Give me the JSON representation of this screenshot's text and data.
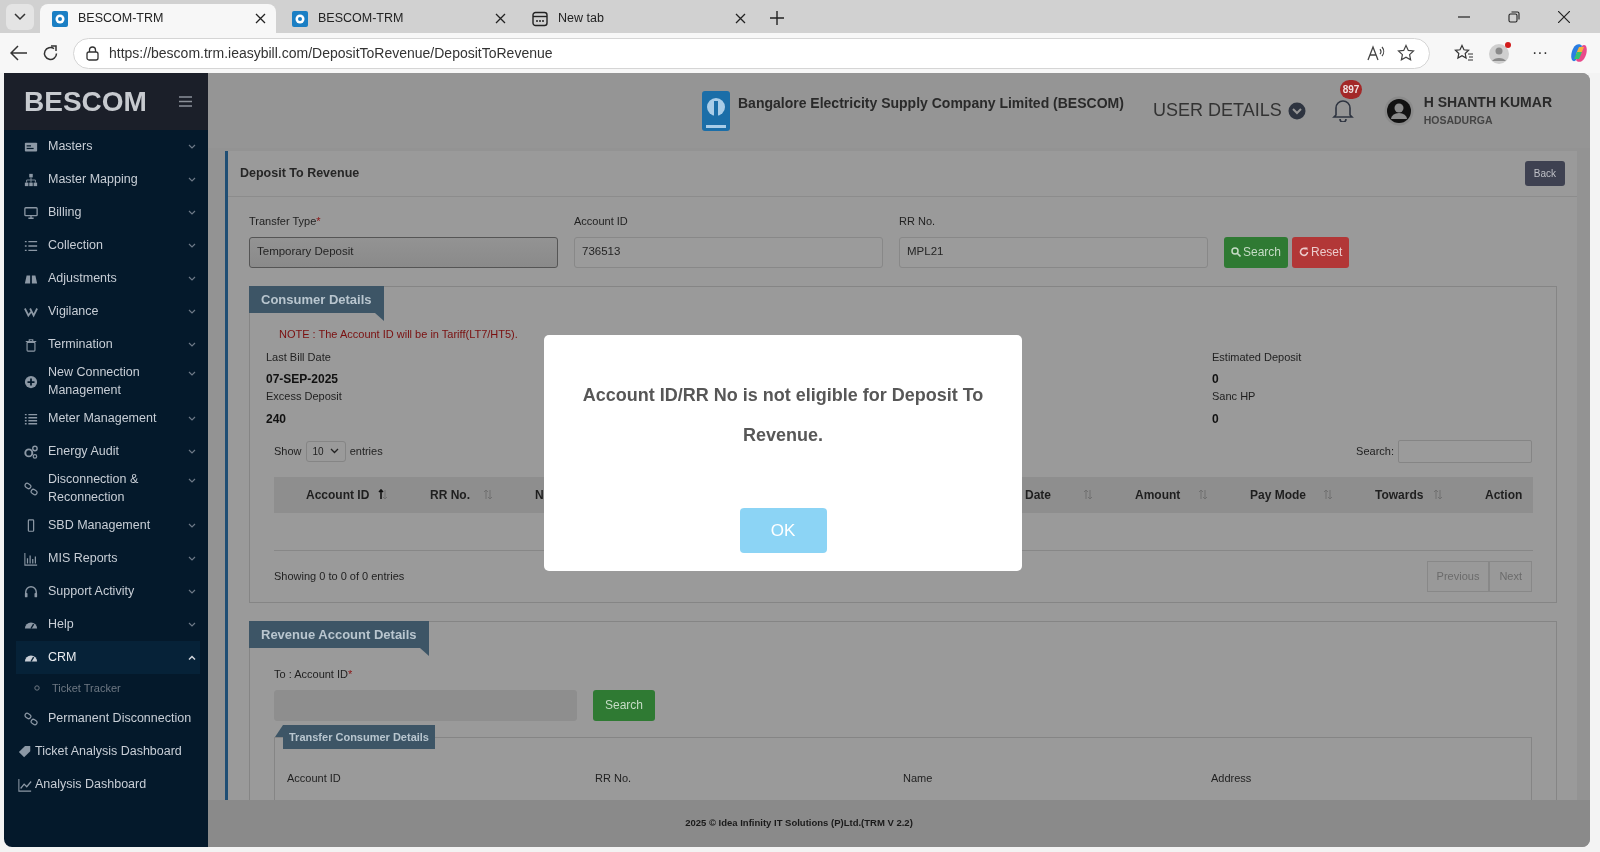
{
  "browser": {
    "tabs": [
      {
        "title": "BESCOM-TRM",
        "selected": true,
        "kind": "site"
      },
      {
        "title": "BESCOM-TRM",
        "selected": false,
        "kind": "site"
      },
      {
        "title": "New tab",
        "selected": false,
        "kind": "newtab"
      }
    ],
    "url": "https://bescom.trm.ieasybill.com/DepositToRevenue/DepositToRevenue",
    "more": "···"
  },
  "sidebar": {
    "brand": "BESCOM",
    "items": [
      {
        "label": "Masters",
        "kind": "menu",
        "expanded": false
      },
      {
        "label": "Master Mapping",
        "kind": "menu",
        "expanded": false
      },
      {
        "label": "Billing",
        "kind": "menu",
        "expanded": false
      },
      {
        "label": "Collection",
        "kind": "menu",
        "expanded": false
      },
      {
        "label": "Adjustments",
        "kind": "menu",
        "expanded": false
      },
      {
        "label": "Vigilance",
        "kind": "menu",
        "expanded": false
      },
      {
        "label": "Termination",
        "kind": "menu",
        "expanded": false
      },
      {
        "label": "New Connection Management",
        "kind": "menu",
        "expanded": false
      },
      {
        "label": "Meter Management",
        "kind": "menu",
        "expanded": false
      },
      {
        "label": "Energy Audit",
        "kind": "menu",
        "expanded": false
      },
      {
        "label": "Disconnection & Reconnection",
        "kind": "menu",
        "expanded": false
      },
      {
        "label": "SBD Management",
        "kind": "menu",
        "expanded": false
      },
      {
        "label": "MIS Reports",
        "kind": "menu",
        "expanded": false
      },
      {
        "label": "Support Activity",
        "kind": "menu",
        "expanded": false
      },
      {
        "label": "Help",
        "kind": "menu",
        "expanded": false
      },
      {
        "label": "CRM",
        "kind": "menu",
        "expanded": true,
        "children": [
          {
            "label": "Ticket Tracker"
          }
        ]
      },
      {
        "label": "Permanent Disconnection",
        "kind": "link"
      },
      {
        "label": "Ticket Analysis Dashboard",
        "kind": "link"
      },
      {
        "label": "Analysis Dashboard",
        "kind": "link"
      }
    ]
  },
  "header": {
    "company": "Bangalore Electricity Supply Company Limited (BESCOM)",
    "user_details": "USER DETAILS",
    "notifications": "897",
    "user_name": "H SHANTH KUMAR",
    "location": "HOSADURGA"
  },
  "page": {
    "title": "Deposit To Revenue",
    "back": "Back",
    "form": {
      "fields": [
        {
          "label": "Transfer Type",
          "required_mark": "*",
          "kind": "select",
          "value": "Temporary Deposit"
        },
        {
          "label": "Account ID",
          "kind": "text",
          "value": "736513"
        },
        {
          "label": "RR No.",
          "kind": "text",
          "value": "MPL21"
        }
      ],
      "buttons": [
        {
          "label": "Search",
          "kind": "search"
        },
        {
          "label": "Reset",
          "kind": "reset"
        }
      ]
    },
    "consumer_details": {
      "title": "Consumer Details",
      "note": "NOTE : The Account ID will be in Tariff(LT7/HT5).",
      "rows": [
        {
          "column_1": {
            "label": "Last Bill Date",
            "value": "07-SEP-2025"
          },
          "column_4": {
            "label": "Estimated Deposit",
            "value": "0"
          }
        },
        {
          "column_1": {
            "label": "Excess Deposit",
            "value": "240"
          },
          "column_4": {
            "label": "Sanc HP",
            "value": "0"
          }
        }
      ],
      "table": {
        "show": "Show",
        "length": "10",
        "entries": "entries",
        "search_label": "Search:",
        "columns": [
          {
            "label": "Account ID",
            "sortable": true,
            "sorted": true
          },
          {
            "label": "RR No.",
            "sortable": true,
            "sorted": false
          },
          {
            "label": "N",
            "sortable": false
          },
          {
            "label": "Date",
            "sortable": true,
            "sorted": false
          },
          {
            "label": "Amount",
            "sortable": true,
            "sorted": false
          },
          {
            "label": "Pay Mode",
            "sortable": true,
            "sorted": false
          },
          {
            "label": "Towards",
            "sortable": true,
            "sorted": false
          },
          {
            "label": "Action",
            "sortable": false
          }
        ],
        "info": "Showing 0 to 0 of 0 entries",
        "previous": {
          "label": "Previous",
          "disabled": true
        },
        "next": {
          "label": "Next",
          "disabled": true
        }
      }
    },
    "revenue_details": {
      "title": "Revenue Account Details",
      "label": "To : Account ID",
      "required_mark": "*",
      "search": "Search",
      "transfer": {
        "title": "Transfer Consumer Details",
        "columns": [
          "Account ID",
          "RR No.",
          "Name",
          "Address"
        ]
      }
    }
  },
  "footer": "2025 © Idea Infinity IT Solutions (P)Ltd.(TRM V 2.2)",
  "dialog": {
    "message": "Account ID/RR No is not eligible for Deposit To Revenue.",
    "button": "OK"
  }
}
